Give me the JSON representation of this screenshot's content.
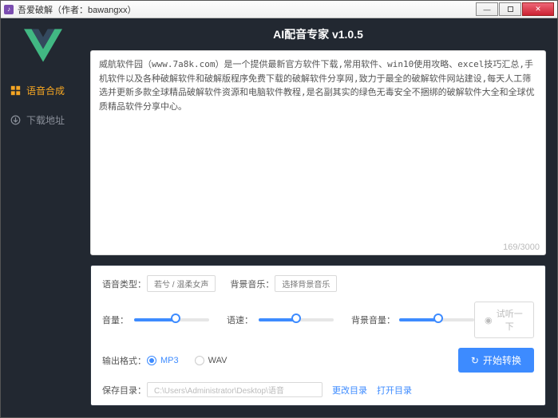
{
  "window": {
    "title": "吾爱破解（作者：bawangxx）"
  },
  "sidebar": {
    "items": [
      {
        "label": "语音合成",
        "active": true
      },
      {
        "label": "下载地址",
        "active": false
      }
    ]
  },
  "app": {
    "title": "AI配音专家 v1.0.5"
  },
  "textarea": {
    "value": "威航软件园（www.7a8k.com）是一个提供最新官方软件下载,常用软件、win10使用攻略、excel技巧汇总,手机软件以及各种破解软件和破解版程序免费下载的破解软件分享网,致力于最全的破解软件网站建设,每天人工筛选并更新多款全球精品破解软件资源和电脑软件教程,是名副其实的绿色无毒安全不捆绑的破解软件大全和全球优质精品软件分享中心。",
    "counter": "169/3000"
  },
  "controls": {
    "voiceTypeLabel": "语音类型：",
    "voiceTypeValue": "若兮 / 温柔女声",
    "bgmLabel": "背景音乐：",
    "bgmValue": "选择背景音乐",
    "volumeLabel": "音量：",
    "speedLabel": "语速：",
    "bgmVolumeLabel": "背景音量：",
    "previewBtn": "试听一下",
    "formatLabel": "输出格式：",
    "formatMp3": "MP3",
    "formatWav": "WAV",
    "convertBtn": "开始转换",
    "saveDirLabel": "保存目录：",
    "saveDirValue": "C:\\Users\\Administrator\\Desktop\\语音",
    "changeDirLink": "更改目录",
    "openDirLink": "打开目录",
    "sliders": {
      "volume": 55,
      "speed": 50,
      "bgmVolume": 52
    }
  }
}
